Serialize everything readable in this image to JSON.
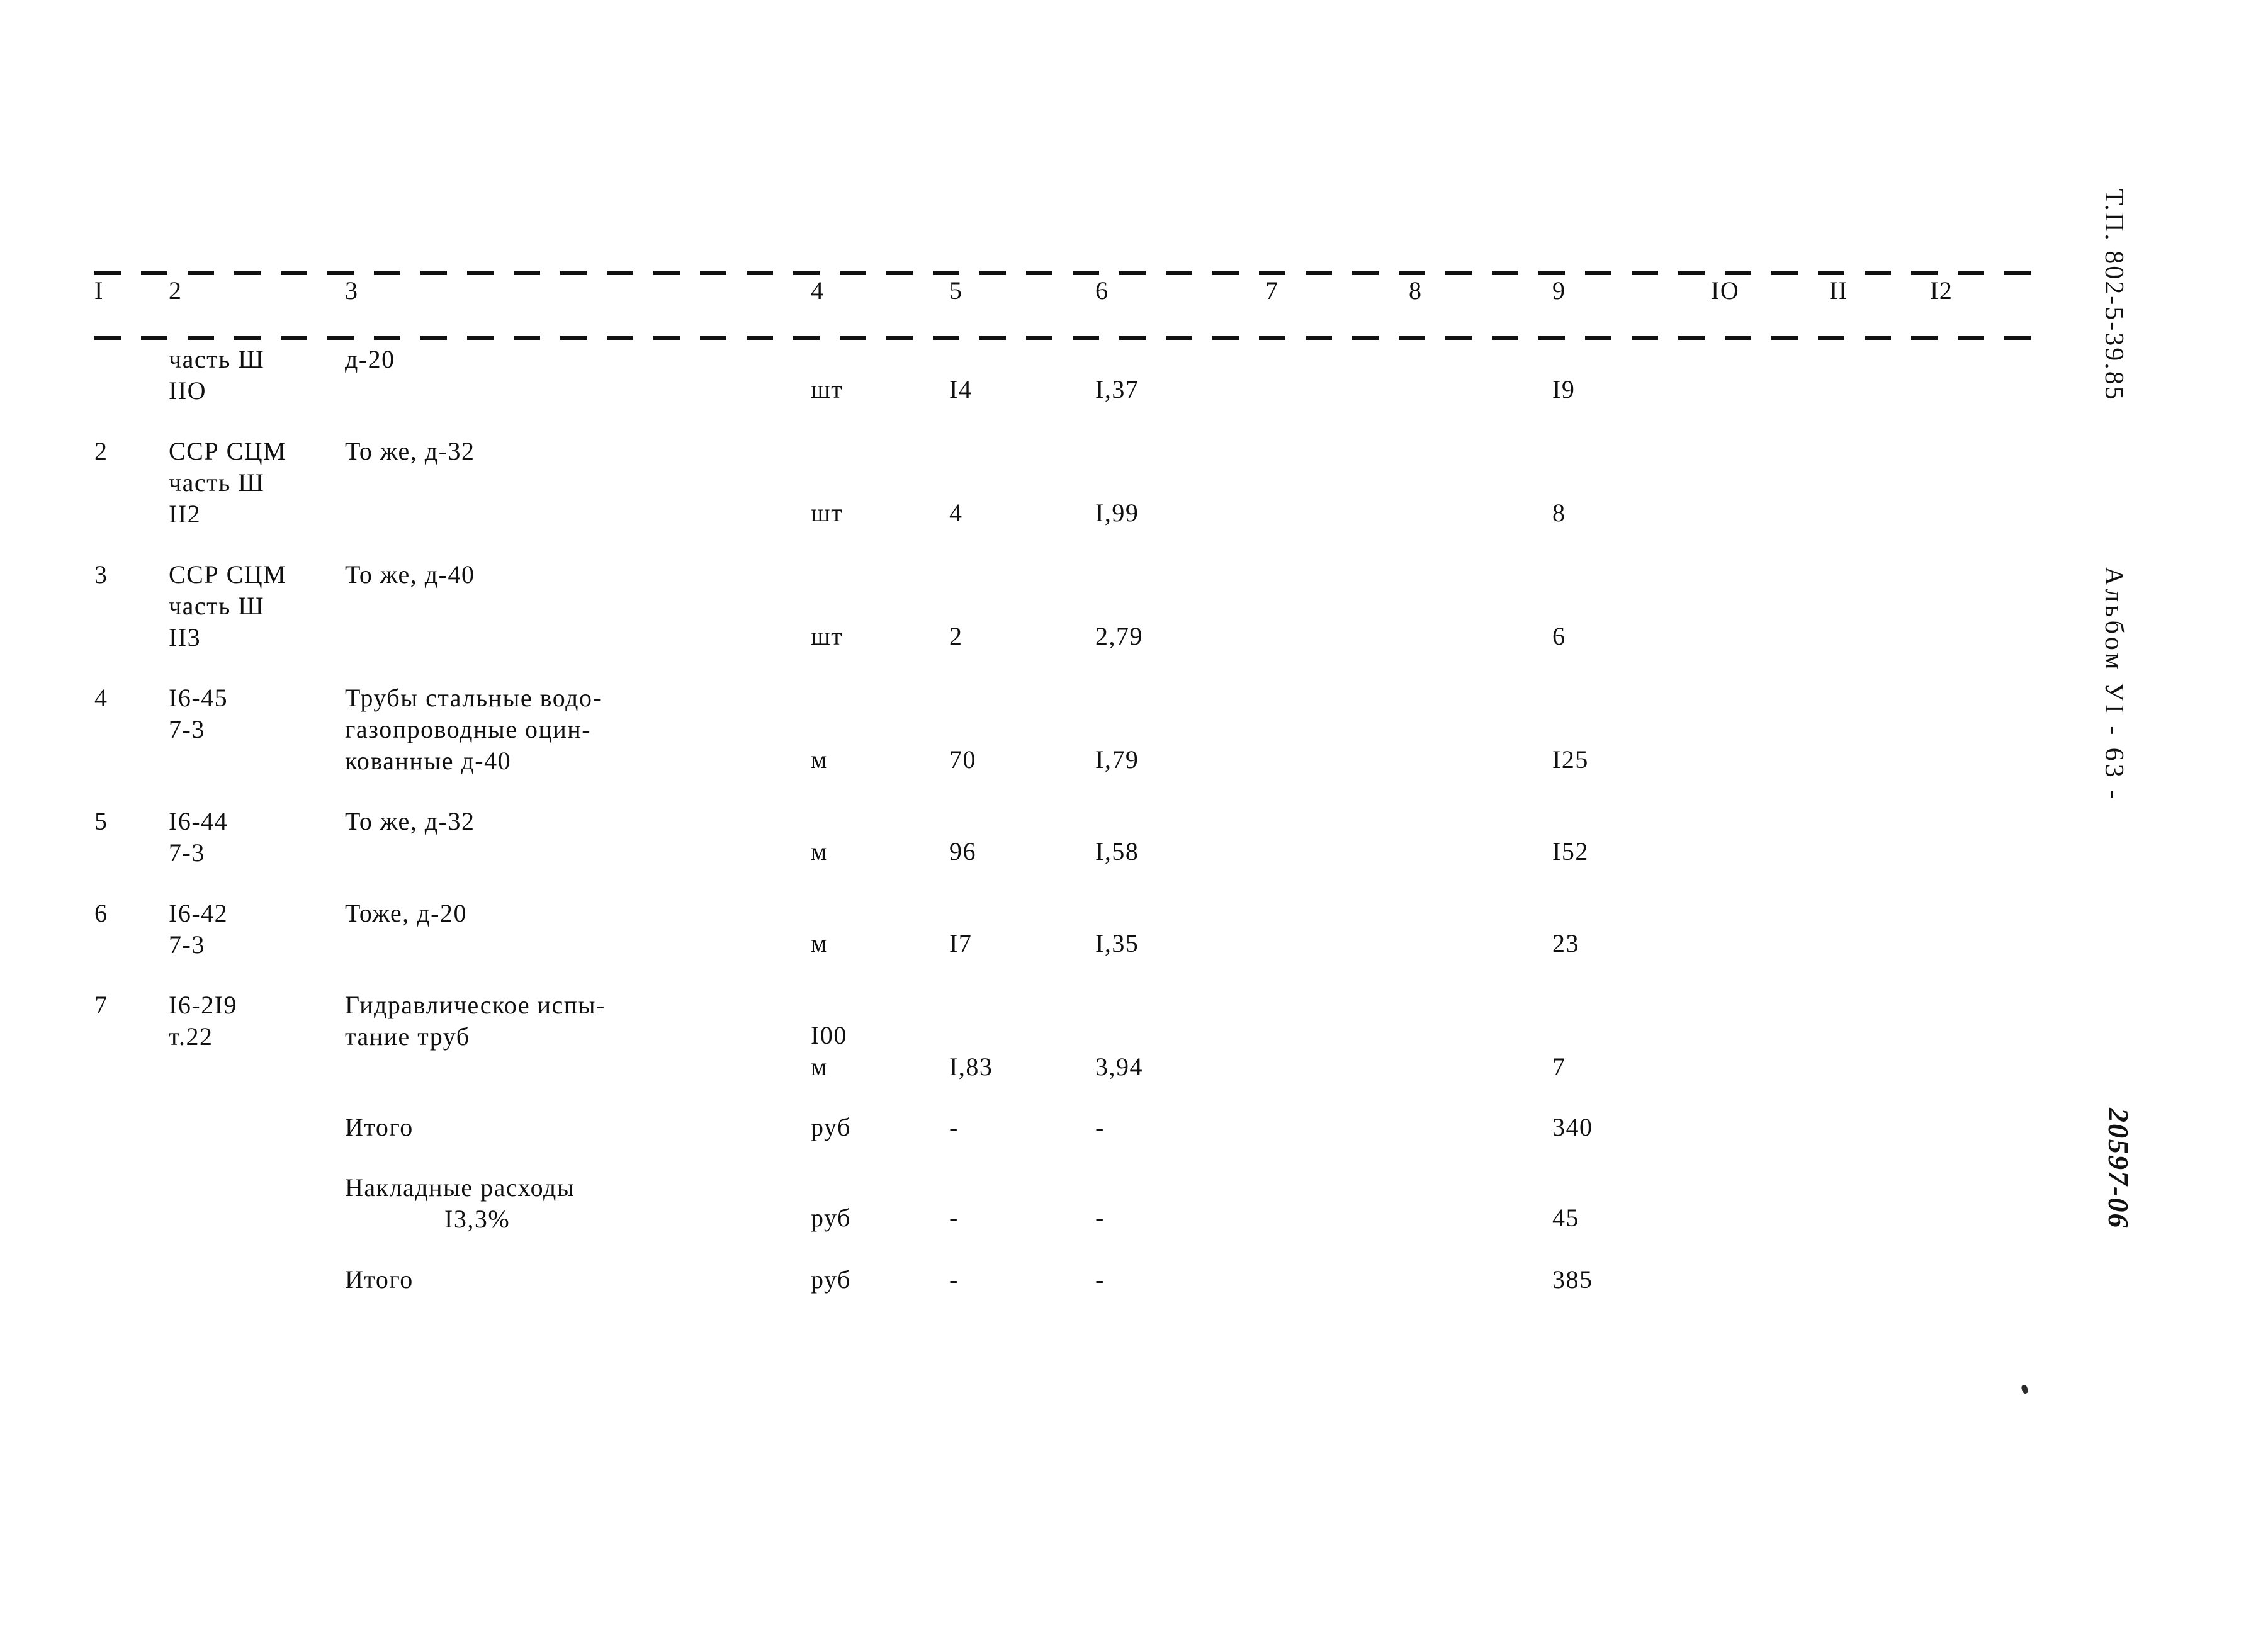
{
  "document": {
    "type_designation": "Т.П. 802-5-39.85",
    "album": "Альбом УI   -  63  -",
    "archive_code": "20597-06"
  },
  "table": {
    "column_numbers": [
      "I",
      "2",
      "3",
      "4",
      "5",
      "6",
      "7",
      "8",
      "9",
      "IO",
      "II",
      "I2"
    ],
    "rows": [
      {
        "num": "",
        "code": "часть Ш\nIIO",
        "descr": "д-20",
        "unit": "шт",
        "qty": "I4",
        "price": "I,37",
        "c7": "",
        "c8": "",
        "total": "I9",
        "c10": "",
        "c11": "",
        "c12": "",
        "unit_drop": "drop1"
      },
      {
        "num": "2",
        "code": "ССР СЦМ\nчасть Ш\nII2",
        "descr": "То же, д-32",
        "unit": "шт",
        "qty": "4",
        "price": "I,99",
        "c7": "",
        "c8": "",
        "total": "8",
        "c10": "",
        "c11": "",
        "c12": "",
        "unit_drop": "drop2"
      },
      {
        "num": "3",
        "code": "ССР СЦМ\nчасть Ш\nII3",
        "descr": "То же, д-40",
        "unit": "шт",
        "qty": "2",
        "price": "2,79",
        "c7": "",
        "c8": "",
        "total": "6",
        "c10": "",
        "c11": "",
        "c12": "",
        "unit_drop": "drop2"
      },
      {
        "num": "4",
        "code": "I6-45\n7-3",
        "descr": "Трубы стальные водо-\nгазопроводные оцин-\nкованные д-40",
        "unit": "м",
        "qty": "70",
        "price": "I,79",
        "c7": "",
        "c8": "",
        "total": "I25",
        "c10": "",
        "c11": "",
        "c12": "",
        "unit_drop": "drop2"
      },
      {
        "num": "5",
        "code": "I6-44\n7-3",
        "descr": "То же, д-32",
        "unit": "м",
        "qty": "96",
        "price": "I,58",
        "c7": "",
        "c8": "",
        "total": "I52",
        "c10": "",
        "c11": "",
        "c12": "",
        "unit_drop": "drop1"
      },
      {
        "num": "6",
        "code": "I6-42\n7-3",
        "descr": "Тоже, д-20",
        "unit": "м",
        "qty": "I7",
        "price": "I,35",
        "c7": "",
        "c8": "",
        "total": "23",
        "c10": "",
        "c11": "",
        "c12": "",
        "unit_drop": "drop1"
      },
      {
        "num": "7",
        "code": "I6-2I9\nт.22",
        "descr": "Гидравлическое испы-\nтание труб",
        "unit": "I00\nм",
        "qty": "I,83",
        "price": "3,94",
        "c7": "",
        "c8": "",
        "total": "7",
        "c10": "",
        "c11": "",
        "c12": "",
        "unit_drop": "drop1"
      },
      {
        "num": "",
        "code": "",
        "descr": "Итого",
        "unit": "руб",
        "qty": "-",
        "price": "-",
        "c7": "",
        "c8": "",
        "total": "340",
        "c10": "",
        "c11": "",
        "c12": "",
        "unit_drop": "cellpad"
      },
      {
        "num": "",
        "code": "",
        "descr": "Накладные расходы",
        "descr_sub": "I3,3%",
        "unit": "руб",
        "qty": "-",
        "price": "-",
        "c7": "",
        "c8": "",
        "total": "45",
        "c10": "",
        "c11": "",
        "c12": "",
        "unit_drop": "drop1"
      },
      {
        "num": "",
        "code": "",
        "descr": "Итого",
        "unit": "руб",
        "qty": "-",
        "price": "-",
        "c7": "",
        "c8": "",
        "total": "385",
        "c10": "",
        "c11": "",
        "c12": "",
        "unit_drop": "cellpad"
      }
    ]
  }
}
